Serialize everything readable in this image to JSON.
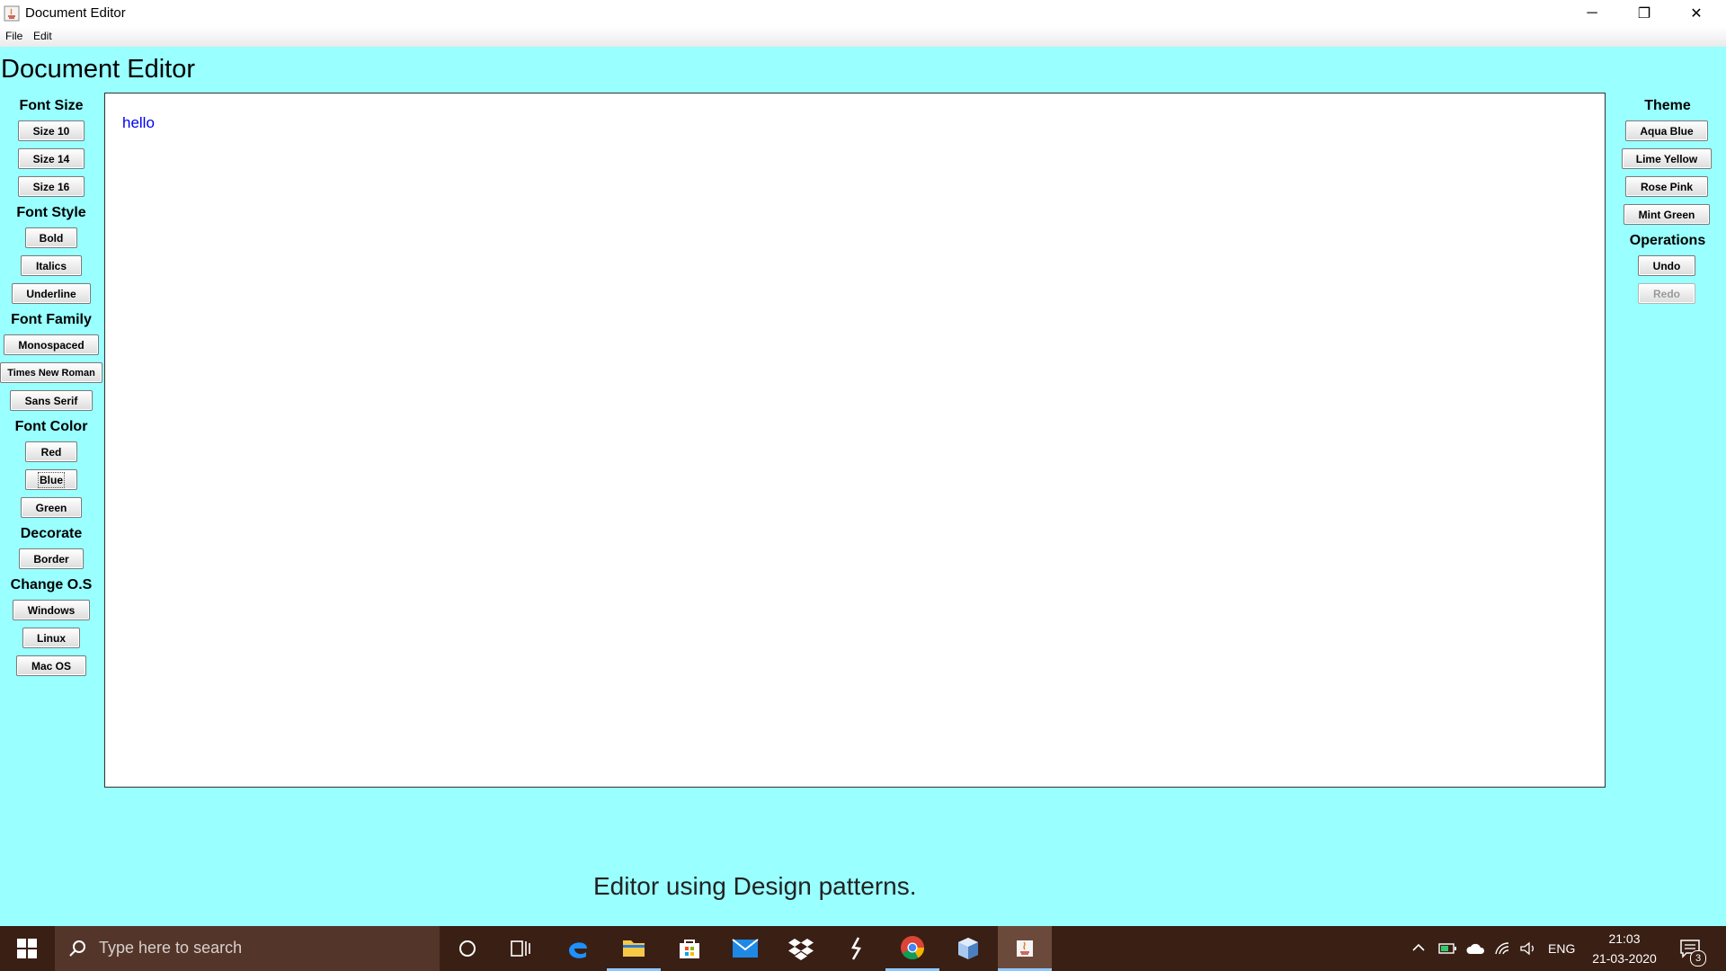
{
  "window": {
    "title": "Document Editor",
    "minimize_glyph": "─",
    "restore_glyph": "❐",
    "close_glyph": "✕"
  },
  "menu": [
    "File",
    "Edit"
  ],
  "app_title": "Document Editor",
  "editor_text": "hello",
  "left_panel": {
    "font_size_title": "Font Size",
    "font_size": [
      "Size 10",
      "Size 14",
      "Size 16"
    ],
    "font_style_title": "Font Style",
    "font_style": [
      "Bold",
      "Italics",
      "Underline"
    ],
    "font_family_title": "Font Family",
    "font_family": [
      "Monospaced",
      "Times New Roman",
      "Sans Serif"
    ],
    "font_color_title": "Font Color",
    "font_color": [
      "Red",
      "Blue",
      "Green"
    ],
    "decorate_title": "Decorate",
    "decorate": [
      "Border"
    ],
    "change_os_title": "Change O.S",
    "change_os": [
      "Windows",
      "Linux",
      "Mac OS"
    ]
  },
  "right_panel": {
    "theme_title": "Theme",
    "theme": [
      "Aqua Blue",
      "Lime Yellow",
      "Rose Pink",
      "Mint Green"
    ],
    "operations_title": "Operations",
    "operations": [
      "Undo",
      "Redo"
    ]
  },
  "footer_text": "Editor using Design patterns.",
  "colors": {
    "background": "#99ffff",
    "editor_text": "#0000ee",
    "taskbar": "#3a1f14"
  },
  "taskbar": {
    "search_placeholder": "Type here to search",
    "icons": [
      "windows-start-icon",
      "search-icon",
      "cortana-icon",
      "task-view-icon",
      "edge-icon",
      "file-explorer-icon",
      "store-icon",
      "mail-icon",
      "dropbox-icon",
      "app-icon",
      "chrome-icon",
      "box-icon",
      "java-icon"
    ],
    "language": "ENG",
    "time": "21:03",
    "date": "21-03-2020",
    "notification_count": "3"
  }
}
